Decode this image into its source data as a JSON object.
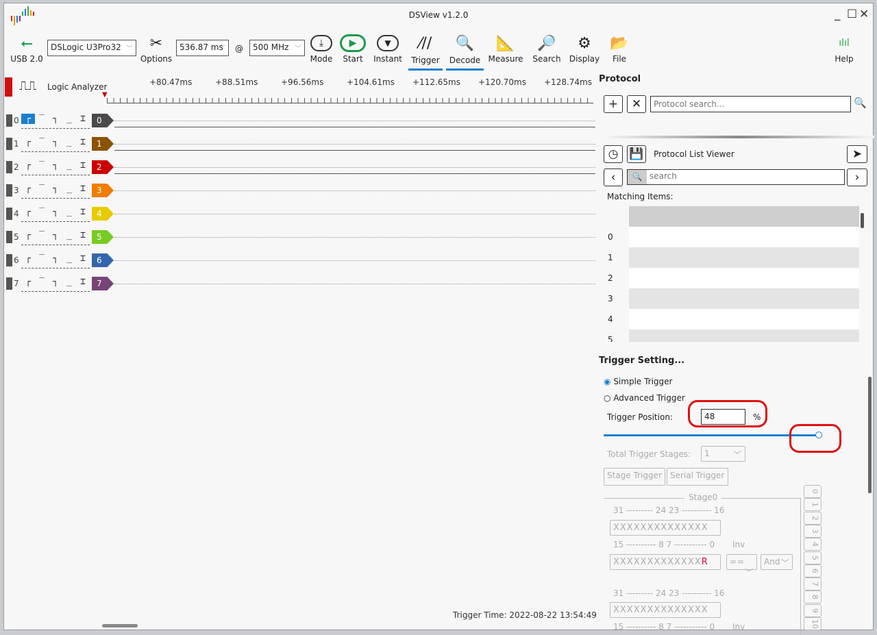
{
  "window": {
    "title": "DSView v1.2.0",
    "minimize": "_",
    "maximize": "☐",
    "close": "✕"
  },
  "toolbar": {
    "usb_label": "USB 2.0",
    "device": "DSLogic U3Pro32",
    "options": "Options",
    "duration": "536.87 ms",
    "at": "@",
    "rate": "500 MHz",
    "mode": "Mode",
    "start": "Start",
    "instant": "Instant",
    "trigger": "Trigger",
    "decode": "Decode",
    "measure": "Measure",
    "search": "Search",
    "display": "Display",
    "file": "File",
    "help": "Help"
  },
  "accent": "#1a7fd0",
  "wave": {
    "mode_label": "Logic Analyzer",
    "ticks": [
      "+80.47ms",
      "+88.51ms",
      "+96.56ms",
      "+104.61ms",
      "+112.65ms",
      "+120.70ms",
      "+128.74ms"
    ],
    "channels": [
      {
        "id": "0",
        "color": "#4a4a4a"
      },
      {
        "id": "1",
        "color": "#8b5200"
      },
      {
        "id": "2",
        "color": "#cc0000"
      },
      {
        "id": "3",
        "color": "#f07c00"
      },
      {
        "id": "4",
        "color": "#e6cc00"
      },
      {
        "id": "5",
        "color": "#77cc22"
      },
      {
        "id": "6",
        "color": "#3366aa"
      },
      {
        "id": "7",
        "color": "#774477"
      }
    ],
    "trigger_time": "Trigger Time: 2022-08-22 13:54:49"
  },
  "protocol": {
    "title": "Protocol",
    "search_placeholder": "Protocol search...",
    "list_viewer": "Protocol List Viewer",
    "search2_placeholder": "search",
    "matching": "Matching Items:",
    "rows": [
      "0",
      "1",
      "2",
      "3",
      "4",
      "5"
    ]
  },
  "trigger": {
    "title": "Trigger Setting...",
    "simple": "Simple Trigger",
    "advanced": "Advanced Trigger",
    "position_label": "Trigger Position:",
    "position_value": "48",
    "percent": "%",
    "position_fraction": 0.48,
    "stages_label": "Total Trigger Stages:",
    "stages_value": "1",
    "tab_stage": "Stage Trigger",
    "tab_serial": "Serial Trigger",
    "stage_name": "Stage0",
    "hi_bits": "31 --------- 24 23 ---------- 16",
    "lo_bits": "15 ---------- 8 7 ----------- 0",
    "inv": "Inv",
    "mask_hi": "XXXXXXXXXXXXXX",
    "mask_lo": "XXXXXXXXXXXXX",
    "mask_lo_last": "R",
    "op": "==",
    "logic": "And",
    "stage_tabs": [
      "0",
      "1",
      "2",
      "3",
      "4",
      "5",
      "6",
      "7",
      "8",
      "9",
      "10"
    ]
  }
}
